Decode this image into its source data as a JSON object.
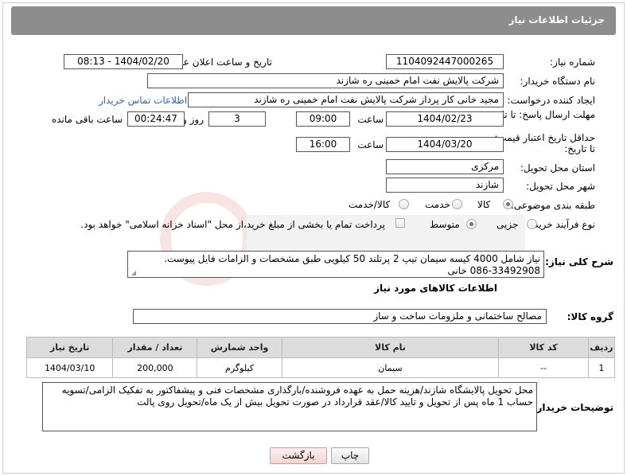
{
  "header": {
    "title": "جزئیات اطلاعات نیاز"
  },
  "fields": {
    "need_number_label": "شماره نیاز:",
    "need_number": "1104092447000265",
    "announce_label": "تاریخ و ساعت اعلان عمومی:",
    "announce_value": "1404/02/20 - 08:13",
    "buyer_org_label": "نام دستگاه خريدار:",
    "buyer_org": "شرکت پالایش نفت امام خمینی  ره  شازند",
    "creator_label": "ایجاد کننده درخواست:",
    "creator": "مجید خانی کار پرداز شرکت پالایش نفت امام خمینی  ره  شازند",
    "contact_link": "اطلاعات تماس خریدار",
    "deadline_label": "مهلت ارسال پاسخ: تا تاریخ:",
    "deadline_date": "1404/02/23",
    "time_label": "ساعت",
    "deadline_time": "09:00",
    "days": "3",
    "days_label": "روز و",
    "remaining": "00:24:47",
    "remaining_label": "ساعت باقی مانده",
    "min_valid_label": "حداقل تاریخ اعتبار قیمت: تا تاریخ:",
    "valid_date": "1404/03/20",
    "valid_time": "16:00",
    "province_label": "استان محل تحویل:",
    "province": "مرکزی",
    "city_label": "شهر محل تحویل:",
    "city": "شازند",
    "category_label": "طبقه بندی موضوعی:",
    "cat_goods": "کالا",
    "cat_service": "خدمت",
    "cat_goods_service": "کالا/خدمت",
    "process_label": "نوع فرآیند خرید :",
    "proc_minor": "جزیی",
    "proc_medium": "متوسط",
    "payment_note": "پرداخت تمام یا بخشی از مبلغ خرید،از محل \"اسناد خزانه اسلامی\" خواهد بود.",
    "description_label": "شرح کلی نیاز:",
    "description": "نیاز شامل 4000 کیسه سیمان تیپ 2 پرتلند 50 کیلویی طبق مشخصات و الزامات فایل پیوست. 33492908-086 خانی",
    "goods_info_title": "اطلاعات کالاهای مورد نیاز",
    "goods_group_label": "گروه کالا:",
    "goods_group": "مصالح ساختمانی و ملزومات ساخت و ساز",
    "buyer_notes_label": "توضیحات خریدار:",
    "buyer_notes": "محل تحویل پالایشگاه شازند/هزینه حمل به عهده فروشنده/بارگذاری مشخصات فنی و پیشفاکتور به تفکیک الزامی/تسویه حساب 1 ماه پس از تحویل و تایید کالا/عقد قرارداد در صورت تحویل بیش از یک ماه/تحویل روی پالت"
  },
  "table": {
    "headers": [
      "ردیف",
      "کد کالا",
      "نام کالا",
      "واحد شمارش",
      "تعداد / مقدار",
      "تاریخ نیاز"
    ],
    "rows": [
      [
        "1",
        "--",
        "سیمان",
        "کیلوگرم",
        "200,000",
        "1404/03/10"
      ]
    ]
  },
  "buttons": {
    "print": "چاپ",
    "back": "بازگشت"
  },
  "colors": {
    "title_bg": "#8d8d8d",
    "link": "#2a6bb0",
    "header_cell": "#dcdcdc"
  }
}
